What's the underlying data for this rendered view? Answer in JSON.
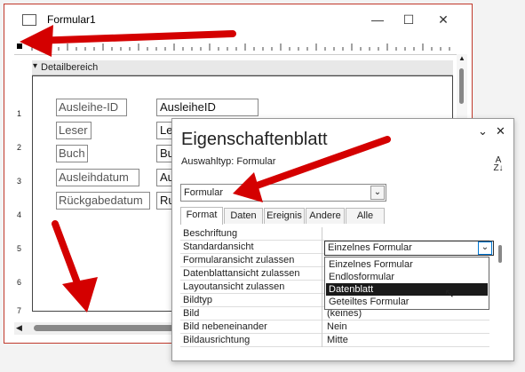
{
  "form_window": {
    "title": "Formular1",
    "minimize_label": "—",
    "maximize_label": "☐",
    "close_label": "✕",
    "section_label": "Detailbereich",
    "ruler_left_numbers": [
      "1",
      "2",
      "3",
      "4",
      "5",
      "6",
      "7"
    ],
    "labels": [
      "Ausleihe-ID",
      "Leser",
      "Buch",
      "Ausleihdatum",
      "Rückgabedatum"
    ],
    "fields": [
      "AusleiheID",
      "Le",
      "Bu",
      "Au",
      "Ru"
    ]
  },
  "prop_sheet": {
    "title": "Eigenschaftenblatt",
    "selection_label": "Auswahltyp:  Formular",
    "sort_label": "A\nZ",
    "object_value": "Formular",
    "tabs": [
      "Format",
      "Daten",
      "Ereignis",
      "Andere",
      "Alle"
    ],
    "properties": [
      {
        "name": "Beschriftung",
        "value": ""
      },
      {
        "name": "Standardansicht",
        "value": "Einzelnes Formular"
      },
      {
        "name": "Formularansicht zulassen",
        "value": ""
      },
      {
        "name": "Datenblattansicht zulassen",
        "value": ""
      },
      {
        "name": "Layoutansicht zulassen",
        "value": ""
      },
      {
        "name": "Bildtyp",
        "value": ""
      },
      {
        "name": "Bild",
        "value": "(keines)"
      },
      {
        "name": "Bild nebeneinander",
        "value": "Nein"
      },
      {
        "name": "Bildausrichtung",
        "value": "Mitte"
      }
    ],
    "dropdown_options": [
      "Einzelnes Formular",
      "Endlosformular",
      "Datenblatt",
      "Geteiltes Formular"
    ],
    "selected_option": "Datenblatt"
  },
  "colors": {
    "arrow": "#d40000",
    "window_border": "#c0392b"
  }
}
